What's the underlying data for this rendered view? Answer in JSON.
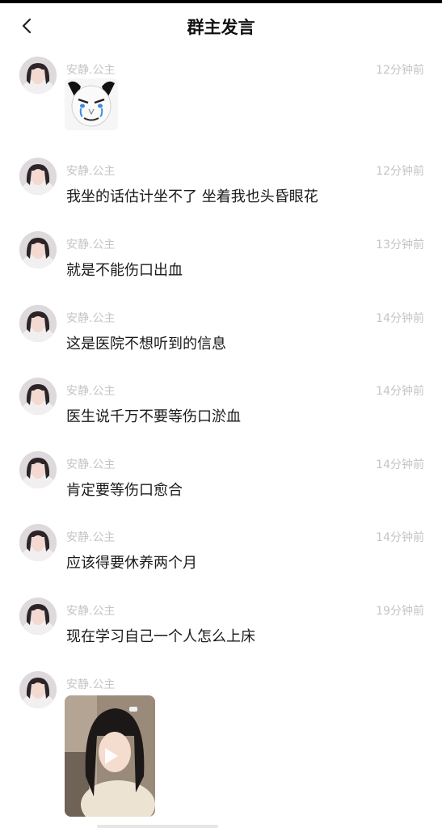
{
  "header": {
    "title": "群主发言"
  },
  "messages": [
    {
      "sender": "安静.公主",
      "time": "12分钟前",
      "type": "sticker"
    },
    {
      "sender": "安静.公主",
      "time": "12分钟前",
      "type": "text",
      "text": "我坐的话估计坐不了 坐着我也头昏眼花"
    },
    {
      "sender": "安静.公主",
      "time": "13分钟前",
      "type": "text",
      "text": "就是不能伤口出血"
    },
    {
      "sender": "安静.公主",
      "time": "14分钟前",
      "type": "text",
      "text": "这是医院不想听到的信息"
    },
    {
      "sender": "安静.公主",
      "time": "14分钟前",
      "type": "text",
      "text": "医生说千万不要等伤口淤血"
    },
    {
      "sender": "安静.公主",
      "time": "14分钟前",
      "type": "text",
      "text": "肯定要等伤口愈合"
    },
    {
      "sender": "安静.公主",
      "time": "14分钟前",
      "type": "text",
      "text": "应该得要休养两个月"
    },
    {
      "sender": "安静.公主",
      "time": "19分钟前",
      "type": "text",
      "text": "现在学习自己一个人怎么上床"
    },
    {
      "sender": "安静.公主",
      "time": "",
      "type": "video"
    }
  ],
  "colors": {
    "meta_text": "#c4c4c4",
    "body_text": "#1a1a1a"
  },
  "icons": {
    "back": "chevron-left-icon",
    "play": "play-icon"
  }
}
